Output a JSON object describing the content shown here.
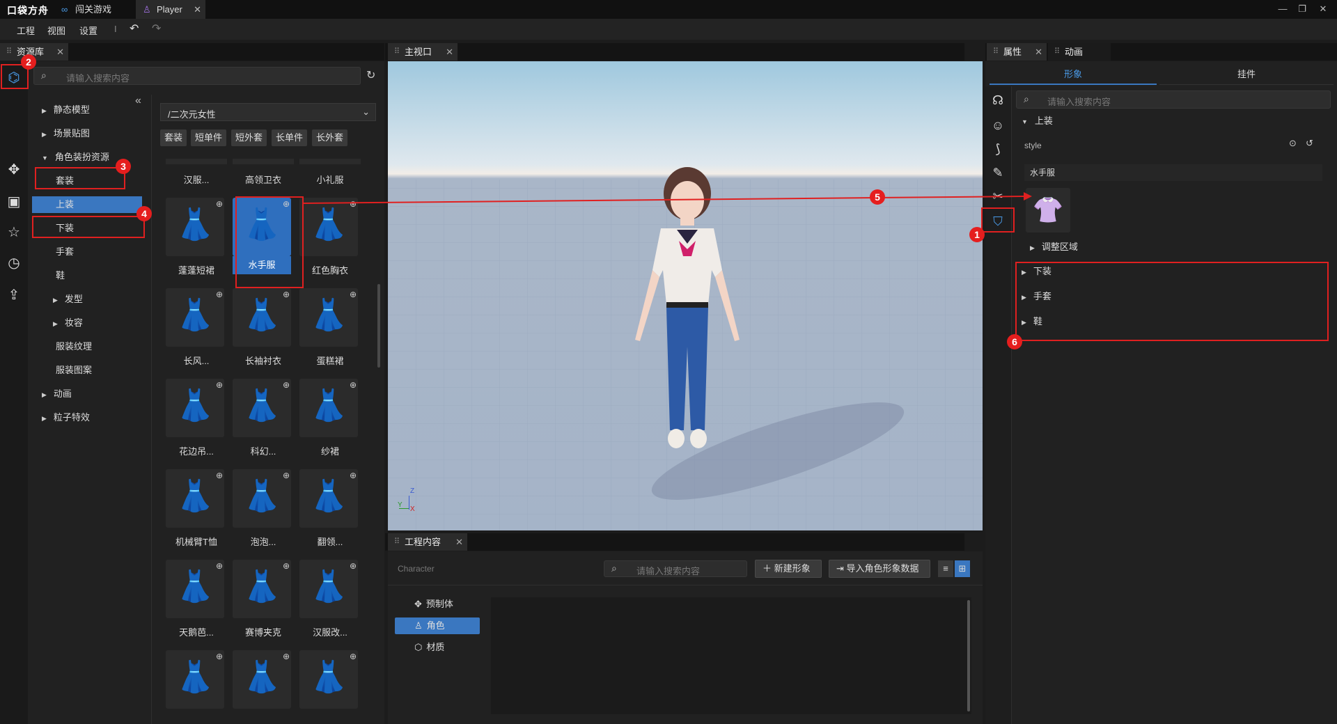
{
  "window": {
    "logo": "口袋方舟",
    "tabs": [
      {
        "label": "闯关游戏",
        "icon": "link-icon"
      },
      {
        "label": "Player",
        "icon": "player-icon"
      }
    ],
    "controls": [
      "—",
      "❐",
      "✕"
    ]
  },
  "menu": {
    "items": [
      "工程",
      "视图",
      "设置"
    ],
    "divider": "I",
    "undo": "↶",
    "redo": "↷"
  },
  "left": {
    "tab": "资源库",
    "search_placeholder": "请输入搜索内容",
    "rail_icons": [
      "assets-icon",
      "components-icon",
      "toolbox-icon",
      "star-icon",
      "history-icon",
      "upload-icon"
    ],
    "tree": [
      {
        "label": "静态模型",
        "level": 0,
        "arrow": "▶"
      },
      {
        "label": "场景贴图",
        "level": 0,
        "arrow": "▶"
      },
      {
        "label": "角色装扮资源",
        "level": 0,
        "arrow": "▼"
      },
      {
        "label": "套装",
        "level": 1,
        "arrow": ""
      },
      {
        "label": "上装",
        "level": 1,
        "arrow": "",
        "selected": true
      },
      {
        "label": "下装",
        "level": 1,
        "arrow": ""
      },
      {
        "label": "手套",
        "level": 1,
        "arrow": ""
      },
      {
        "label": "鞋",
        "level": 1,
        "arrow": ""
      },
      {
        "label": "发型",
        "level": 1,
        "arrow": "▶"
      },
      {
        "label": "妆容",
        "level": 1,
        "arrow": "▶"
      },
      {
        "label": "服装纹理",
        "level": 1,
        "arrow": ""
      },
      {
        "label": "服装图案",
        "level": 1,
        "arrow": ""
      },
      {
        "label": "动画",
        "level": 0,
        "arrow": "▶"
      },
      {
        "label": "粒子特效",
        "level": 0,
        "arrow": "▶"
      }
    ],
    "collapse": "«",
    "dropdown": "/二次元女性",
    "chips": [
      "套装",
      "短单件",
      "短外套",
      "长单件",
      "长外套"
    ],
    "top_row": [
      "汉服...",
      "高领卫衣",
      "小礼服"
    ],
    "assets": [
      {
        "label": "蓬蓬短裙",
        "color": "#e8d2d6"
      },
      {
        "label": "水手服",
        "color": "#f4f4f4",
        "selected": true
      },
      {
        "label": "红色胸衣",
        "color": "#e8b0a0"
      },
      {
        "label": "长风...",
        "color": "#e8b43a"
      },
      {
        "label": "长袖衬衣",
        "color": "#f0f0f0"
      },
      {
        "label": "蛋糕裙",
        "color": "#9ec8e6"
      },
      {
        "label": "花边吊...",
        "color": "#8ed6d0"
      },
      {
        "label": "科幻...",
        "color": "#cfcfcf"
      },
      {
        "label": "纱裙",
        "color": "#f0e2c0"
      },
      {
        "label": "机械臂T恤",
        "color": "#9ee0e0"
      },
      {
        "label": "泡泡...",
        "color": "#6b6fc0"
      },
      {
        "label": "翻领...",
        "color": "#8a8a8a"
      },
      {
        "label": "天鹅芭...",
        "color": "#f4f4f4"
      },
      {
        "label": "赛博夹克",
        "color": "#5a5a5a"
      },
      {
        "label": "汉服改...",
        "color": "#e0a0b0"
      },
      {
        "label": "",
        "color": "#e090c0"
      },
      {
        "label": "",
        "color": "#f0e6dc"
      },
      {
        "label": "",
        "color": "#3a2f50"
      }
    ]
  },
  "viewport": {
    "tab": "主视口",
    "axes": {
      "z": "Z",
      "y": "Y",
      "x": "X"
    }
  },
  "project": {
    "tab": "工程内容",
    "label": "Character",
    "search_placeholder": "请输入搜索内容",
    "new_button": "新建形象",
    "import_button": "导入角色形象数据",
    "list": [
      {
        "label": "预制体",
        "icon": "prefab-icon"
      },
      {
        "label": "角色",
        "icon": "character-icon",
        "selected": true
      },
      {
        "label": "材质",
        "icon": "material-icon"
      }
    ]
  },
  "right": {
    "tabs": [
      "属性",
      "动画"
    ],
    "subtabs": [
      "形象",
      "挂件"
    ],
    "search_placeholder": "请输入搜索内容",
    "section_top": "上装",
    "style_label": "style",
    "style_value": "水手服",
    "adjust_label": "调整区域",
    "sections": [
      "下装",
      "手套",
      "鞋"
    ],
    "rail_icons": [
      "head-icon",
      "face-icon",
      "body-icon",
      "brush-icon",
      "scissors-icon",
      "shirt-icon"
    ]
  },
  "annotations": [
    "1",
    "2",
    "3",
    "4",
    "5",
    "6"
  ],
  "colors": {
    "accent": "#3a77c0",
    "annotation": "#e02020"
  }
}
